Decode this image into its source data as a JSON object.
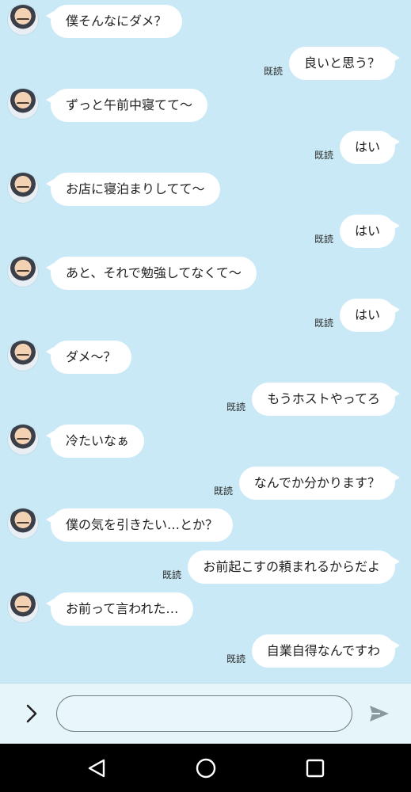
{
  "messages": [
    {
      "side": "left",
      "text": "僕そんなにダメ？"
    },
    {
      "side": "right",
      "text": "良いと思う？",
      "read": "既読"
    },
    {
      "side": "left",
      "text": "ずっと午前中寝てて〜"
    },
    {
      "side": "right",
      "text": "はい",
      "read": "既読"
    },
    {
      "side": "left",
      "text": "お店に寝泊まりしてて〜"
    },
    {
      "side": "right",
      "text": "はい",
      "read": "既読"
    },
    {
      "side": "left",
      "text": "あと、それで勉強してなくて〜"
    },
    {
      "side": "right",
      "text": "はい",
      "read": "既読"
    },
    {
      "side": "left",
      "text": "ダメ〜？"
    },
    {
      "side": "right",
      "text": "もうホストやってろ",
      "read": "既読"
    },
    {
      "side": "left",
      "text": "冷たいなぁ"
    },
    {
      "side": "right",
      "text": "なんでか分かります？",
      "read": "既読"
    },
    {
      "side": "left",
      "text": "僕の気を引きたい…とか？"
    },
    {
      "side": "right",
      "text": "お前起こすの頼まれるからだよ",
      "read": "既読"
    },
    {
      "side": "left",
      "text": "お前って言われた…"
    },
    {
      "side": "right",
      "text": "自業自得なんですわ",
      "read": "既読"
    }
  ],
  "input": {
    "value": "",
    "placeholder": ""
  },
  "icons": {
    "expand": "chevron-right-icon",
    "send": "send-icon",
    "back": "nav-back-icon",
    "home": "nav-home-icon",
    "recents": "nav-recents-icon"
  },
  "colors": {
    "background": "#c8e9f5",
    "bubble": "#ffffff",
    "navbar": "#000000"
  }
}
